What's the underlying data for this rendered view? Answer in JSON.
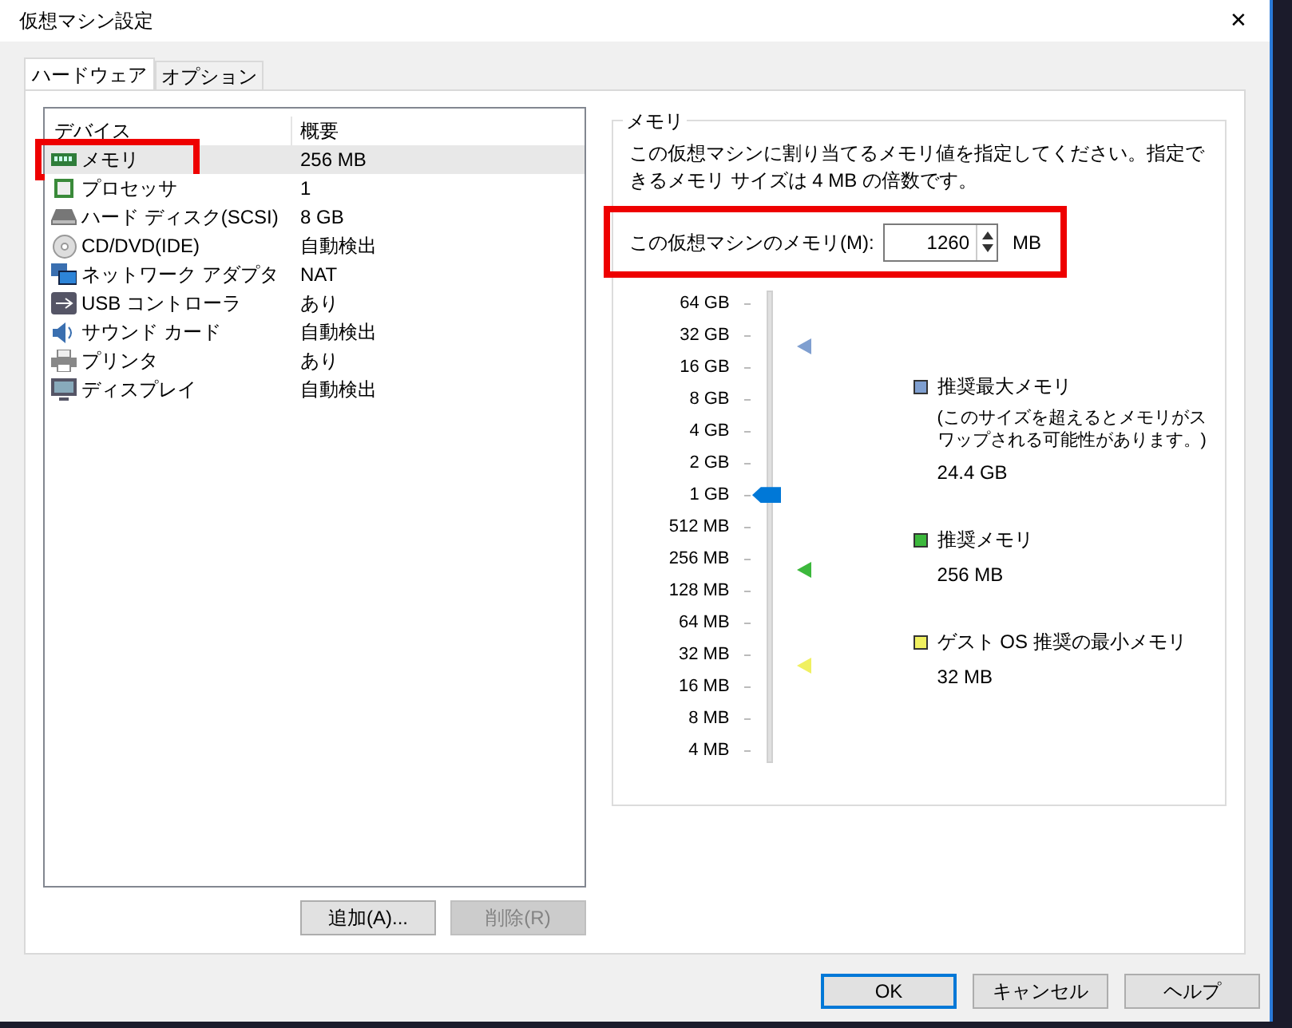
{
  "window": {
    "title": "仮想マシン設定",
    "close": "✕"
  },
  "tabs": [
    {
      "label": "ハードウェア",
      "selected": true
    },
    {
      "label": "オプション",
      "selected": false
    }
  ],
  "devices": {
    "columns": [
      "デバイス",
      "概要"
    ],
    "rows": [
      {
        "name": "メモリ",
        "summary": "256 MB",
        "selected": true,
        "annotated": true
      },
      {
        "name": "プロセッサ",
        "summary": "1",
        "selected": false,
        "annotated": false
      },
      {
        "name": "ハード ディスク(SCSI)",
        "summary": "8 GB",
        "selected": false,
        "annotated": false
      },
      {
        "name": "CD/DVD(IDE)",
        "summary": "自動検出",
        "selected": false,
        "annotated": false
      },
      {
        "name": "ネットワーク アダプタ",
        "summary": "NAT",
        "selected": false,
        "annotated": false
      },
      {
        "name": "USB コントローラ",
        "summary": "あり",
        "selected": false,
        "annotated": false
      },
      {
        "name": "サウンド カード",
        "summary": "自動検出",
        "selected": false,
        "annotated": false
      },
      {
        "name": "プリンタ",
        "summary": "あり",
        "selected": false,
        "annotated": false
      },
      {
        "name": "ディスプレイ",
        "summary": "自動検出",
        "selected": false,
        "annotated": false
      }
    ],
    "buttons": [
      {
        "label": "追加(A)...",
        "disabled": false
      },
      {
        "label": "削除(R)",
        "disabled": true
      }
    ]
  },
  "memory": {
    "group_title": "メモリ",
    "description": "この仮想マシンに割り当てるメモリ値を指定してください。指定できるメモリ サイズは 4 MB の倍数です。",
    "field": {
      "label": "この仮想マシンのメモリ(M):",
      "value": "1260",
      "unit": "MB",
      "annotated": true
    },
    "slider": {
      "ticks": [
        {
          "label": "64 GB"
        },
        {
          "label": "32 GB",
          "color": "#7f9fd0"
        },
        {
          "label": "16 GB"
        },
        {
          "label": "8 GB"
        },
        {
          "label": "4 GB"
        },
        {
          "label": "2 GB"
        },
        {
          "label": "1 GB"
        },
        {
          "label": "512 MB"
        },
        {
          "label": "256 MB",
          "color": "#3cb83c"
        },
        {
          "label": "128 MB"
        },
        {
          "label": "64 MB"
        },
        {
          "label": "32 MB",
          "color": "#f0f060"
        },
        {
          "label": "16 MB"
        },
        {
          "label": "8 MB"
        },
        {
          "label": "4 MB"
        }
      ],
      "level": 0.571
    },
    "legend": [
      {
        "label": "推奨最大メモリ",
        "note": "(このサイズを超えるとメモリがスワップされる可能性があります。)",
        "value": "24.4 GB",
        "color": "#7f9fd0"
      },
      {
        "label": "推奨メモリ",
        "value": "256 MB",
        "color": "#3cb83c"
      },
      {
        "label": "ゲスト OS 推奨の最小メモリ",
        "value": "32 MB",
        "color": "#f0f060"
      }
    ]
  },
  "footer_buttons": [
    {
      "label": "OK",
      "default": true
    },
    {
      "label": "キャンセル",
      "default": false
    },
    {
      "label": "ヘルプ",
      "default": false
    }
  ]
}
